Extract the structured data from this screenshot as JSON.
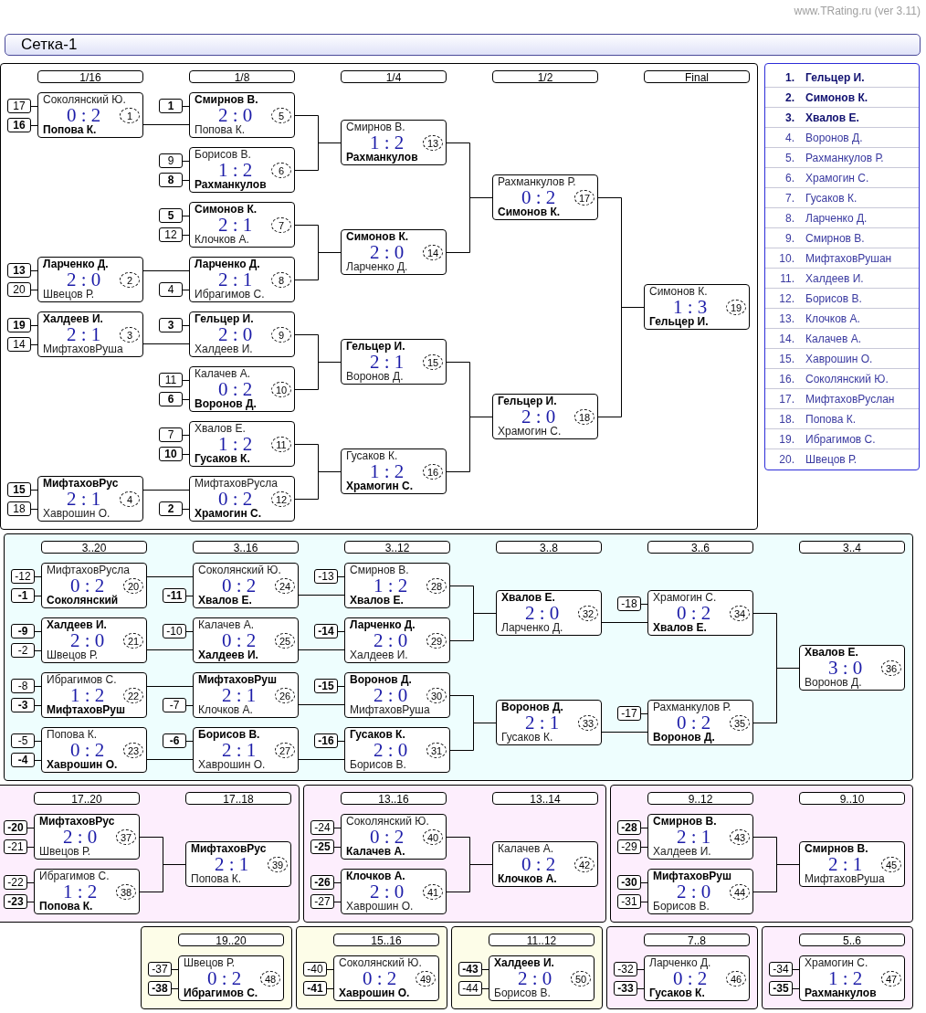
{
  "site": "www.TRating.ru (ver 3.11)",
  "title": "Сетка-1",
  "standings": [
    {
      "rank": "1.",
      "name": "Гельцер И.",
      "highlighted": true
    },
    {
      "rank": "2.",
      "name": "Симонов К.",
      "highlighted": true
    },
    {
      "rank": "3.",
      "name": "Хвалов Е.",
      "highlighted": true
    },
    {
      "rank": "4.",
      "name": "Воронов Д.",
      "highlighted": false
    },
    {
      "rank": "5.",
      "name": "Рахманкулов Р.",
      "highlighted": false
    },
    {
      "rank": "6.",
      "name": "Храмогин С.",
      "highlighted": false
    },
    {
      "rank": "7.",
      "name": "Гусаков К.",
      "highlighted": false
    },
    {
      "rank": "8.",
      "name": "Ларченко Д.",
      "highlighted": false
    },
    {
      "rank": "9.",
      "name": "Смирнов В.",
      "highlighted": false
    },
    {
      "rank": "10.",
      "name": "МифтаховРушан",
      "highlighted": false
    },
    {
      "rank": "11.",
      "name": "Халдеев И.",
      "highlighted": false
    },
    {
      "rank": "12.",
      "name": "Борисов В.",
      "highlighted": false
    },
    {
      "rank": "13.",
      "name": "Клочков А.",
      "highlighted": false
    },
    {
      "rank": "14.",
      "name": "Калачев А.",
      "highlighted": false
    },
    {
      "rank": "15.",
      "name": "Хаврошин О.",
      "highlighted": false
    },
    {
      "rank": "16.",
      "name": "Соколянский Ю.",
      "highlighted": false
    },
    {
      "rank": "17.",
      "name": "МифтаховРуслан",
      "highlighted": false
    },
    {
      "rank": "18.",
      "name": "Попова К.",
      "highlighted": false
    },
    {
      "rank": "19.",
      "name": "Ибрагимов С.",
      "highlighted": false
    },
    {
      "rank": "20.",
      "name": "Швецов Р.",
      "highlighted": false
    }
  ],
  "rows": [
    {
      "panels": [
        {
          "color": "#ffffff",
          "rounds": [
            "1/16",
            "1/8",
            "1/4",
            "1/2",
            "Final"
          ],
          "final": {
            "number": "19",
            "score": "1 : 3",
            "players": [
              {
                "name": "Симонов К.",
                "winner": false
              },
              {
                "name": "Гельцер И.",
                "winner": true
              }
            ],
            "feeders": [
              {
                "number": "17",
                "score": "0 : 2",
                "players": [
                  {
                    "name": "Рахманкулов Р.",
                    "winner": false
                  },
                  {
                    "name": "Симонов К.",
                    "winner": true
                  }
                ],
                "feeders": [
                  {
                    "number": "13",
                    "score": "1 : 2",
                    "players": [
                      {
                        "name": "Смирнов В.",
                        "winner": false
                      },
                      {
                        "name": "Рахманкулов",
                        "winner": true
                      }
                    ],
                    "feeders": [
                      {
                        "number": "5",
                        "score": "2 : 0",
                        "players": [
                          {
                            "seed": "1",
                            "name": "Смирнов В.",
                            "winner": true
                          },
                          {
                            "name": "Попова К.",
                            "winner": false
                          }
                        ],
                        "feeders": [
                          {
                            "number": "1",
                            "score": "0 : 2",
                            "players": [
                              {
                                "seed": "17",
                                "name": "Соколянский Ю.",
                                "winner": false
                              },
                              {
                                "seed": "16",
                                "name": "Попова К.",
                                "winner": true
                              }
                            ]
                          }
                        ]
                      },
                      {
                        "number": "6",
                        "score": "1 : 2",
                        "players": [
                          {
                            "seed": "9",
                            "name": "Борисов В.",
                            "winner": false
                          },
                          {
                            "seed": "8",
                            "name": "Рахманкулов",
                            "winner": true
                          }
                        ]
                      }
                    ]
                  },
                  {
                    "number": "14",
                    "score": "2 : 0",
                    "players": [
                      {
                        "name": "Симонов К.",
                        "winner": true
                      },
                      {
                        "name": "Ларченко Д.",
                        "winner": false
                      }
                    ],
                    "feeders": [
                      {
                        "number": "7",
                        "score": "2 : 1",
                        "players": [
                          {
                            "seed": "5",
                            "name": "Симонов К.",
                            "winner": true
                          },
                          {
                            "seed": "12",
                            "name": "Клочков А.",
                            "winner": false
                          }
                        ]
                      },
                      {
                        "number": "8",
                        "score": "2 : 1",
                        "players": [
                          {
                            "name": "Ларченко Д.",
                            "winner": true
                          },
                          {
                            "seed": "4",
                            "name": "Ибрагимов С.",
                            "winner": false
                          }
                        ],
                        "feeders": [
                          {
                            "number": "2",
                            "score": "2 : 0",
                            "players": [
                              {
                                "seed": "13",
                                "name": "Ларченко Д.",
                                "winner": true
                              },
                              {
                                "seed": "20",
                                "name": "Швецов Р.",
                                "winner": false
                              }
                            ]
                          }
                        ]
                      }
                    ]
                  }
                ]
              },
              {
                "number": "18",
                "score": "2 : 0",
                "players": [
                  {
                    "name": "Гельцер И.",
                    "winner": true
                  },
                  {
                    "name": "Храмогин С.",
                    "winner": false
                  }
                ],
                "feeders": [
                  {
                    "number": "15",
                    "score": "2 : 1",
                    "players": [
                      {
                        "name": "Гельцер И.",
                        "winner": true
                      },
                      {
                        "name": "Воронов Д.",
                        "winner": false
                      }
                    ],
                    "feeders": [
                      {
                        "number": "9",
                        "score": "2 : 0",
                        "players": [
                          {
                            "seed": "3",
                            "name": "Гельцер И.",
                            "winner": true
                          },
                          {
                            "name": "Халдеев И.",
                            "winner": false
                          }
                        ],
                        "feeders": [
                          {
                            "number": "3",
                            "score": "2 : 1",
                            "players": [
                              {
                                "seed": "19",
                                "name": "Халдеев И.",
                                "winner": true
                              },
                              {
                                "seed": "14",
                                "name": "МифтаховРуша",
                                "winner": false
                              }
                            ]
                          }
                        ]
                      },
                      {
                        "number": "10",
                        "score": "0 : 2",
                        "players": [
                          {
                            "seed": "11",
                            "name": "Калачев А.",
                            "winner": false
                          },
                          {
                            "seed": "6",
                            "name": "Воронов Д.",
                            "winner": true
                          }
                        ]
                      }
                    ]
                  },
                  {
                    "number": "16",
                    "score": "1 : 2",
                    "players": [
                      {
                        "name": "Гусаков К.",
                        "winner": false
                      },
                      {
                        "name": "Храмогин С.",
                        "winner": true
                      }
                    ],
                    "feeders": [
                      {
                        "number": "11",
                        "score": "1 : 2",
                        "players": [
                          {
                            "seed": "7",
                            "name": "Хвалов Е.",
                            "winner": false
                          },
                          {
                            "seed": "10",
                            "name": "Гусаков К.",
                            "winner": true
                          }
                        ]
                      },
                      {
                        "number": "12",
                        "score": "0 : 2",
                        "players": [
                          {
                            "name": "МифтаховРусла",
                            "winner": false
                          },
                          {
                            "seed": "2",
                            "name": "Храмогин С.",
                            "winner": true
                          }
                        ],
                        "feeders": [
                          {
                            "number": "4",
                            "score": "2 : 1",
                            "players": [
                              {
                                "seed": "15",
                                "name": "МифтаховРус",
                                "winner": true
                              },
                              {
                                "seed": "18",
                                "name": "Хаврошин О.",
                                "winner": false
                              }
                            ]
                          }
                        ]
                      }
                    ]
                  }
                ]
              }
            ]
          }
        }
      ]
    },
    {
      "panels": [
        {
          "color": "#eefefe",
          "rounds": [
            "3..20",
            "3..16",
            "3..12",
            "3..8",
            "3..6",
            "3..4"
          ],
          "final": {
            "number": "36",
            "score": "3 : 0",
            "players": [
              {
                "name": "Хвалов Е.",
                "winner": true
              },
              {
                "name": "Воронов Д.",
                "winner": false
              }
            ],
            "feeders": [
              {
                "number": "34",
                "score": "0 : 2",
                "players": [
                  {
                    "seed": "-18",
                    "name": "Храмогин С.",
                    "winner": false
                  },
                  {
                    "name": "Хвалов Е.",
                    "winner": true
                  }
                ],
                "feeders": [
                  {
                    "number": "32",
                    "score": "2 : 0",
                    "players": [
                      {
                        "name": "Хвалов Е.",
                        "winner": true
                      },
                      {
                        "name": "Ларченко Д.",
                        "winner": false
                      }
                    ],
                    "feeders": [
                      {
                        "number": "28",
                        "score": "1 : 2",
                        "players": [
                          {
                            "seed": "-13",
                            "name": "Смирнов В.",
                            "winner": false
                          },
                          {
                            "name": "Хвалов Е.",
                            "winner": true
                          }
                        ],
                        "feeders": [
                          {
                            "number": "24",
                            "score": "0 : 2",
                            "players": [
                              {
                                "name": "Соколянский Ю.",
                                "winner": false
                              },
                              {
                                "seed": "-11",
                                "name": "Хвалов Е.",
                                "winner": true
                              }
                            ],
                            "feeders": [
                              {
                                "number": "20",
                                "score": "0 : 2",
                                "players": [
                                  {
                                    "seed": "-12",
                                    "name": "МифтаховРусла",
                                    "winner": false
                                  },
                                  {
                                    "seed": "-1",
                                    "name": "Соколянский",
                                    "winner": true
                                  }
                                ]
                              }
                            ]
                          }
                        ]
                      },
                      {
                        "number": "29",
                        "score": "2 : 0",
                        "players": [
                          {
                            "seed": "-14",
                            "name": "Ларченко Д.",
                            "winner": true
                          },
                          {
                            "name": "Халдеев И.",
                            "winner": false
                          }
                        ],
                        "feeders": [
                          {
                            "number": "25",
                            "score": "0 : 2",
                            "players": [
                              {
                                "seed": "-10",
                                "name": "Калачев А.",
                                "winner": false
                              },
                              {
                                "name": "Халдеев И.",
                                "winner": true
                              }
                            ],
                            "feeders": [
                              {
                                "number": "21",
                                "score": "2 : 0",
                                "players": [
                                  {
                                    "seed": "-9",
                                    "name": "Халдеев И.",
                                    "winner": true
                                  },
                                  {
                                    "seed": "-2",
                                    "name": "Швецов Р.",
                                    "winner": false
                                  }
                                ]
                              }
                            ]
                          }
                        ]
                      }
                    ]
                  }
                ]
              },
              {
                "number": "35",
                "score": "0 : 2",
                "players": [
                  {
                    "seed": "-17",
                    "name": "Рахманкулов Р.",
                    "winner": false
                  },
                  {
                    "name": "Воронов Д.",
                    "winner": true
                  }
                ],
                "feeders": [
                  {
                    "number": "33",
                    "score": "2 : 1",
                    "players": [
                      {
                        "name": "Воронов Д.",
                        "winner": true
                      },
                      {
                        "name": "Гусаков К.",
                        "winner": false
                      }
                    ],
                    "feeders": [
                      {
                        "number": "30",
                        "score": "2 : 0",
                        "players": [
                          {
                            "seed": "-15",
                            "name": "Воронов Д.",
                            "winner": true
                          },
                          {
                            "name": "МифтаховРуша",
                            "winner": false
                          }
                        ],
                        "feeders": [
                          {
                            "number": "26",
                            "score": "2 : 1",
                            "players": [
                              {
                                "name": "МифтаховРуш",
                                "winner": true
                              },
                              {
                                "seed": "-7",
                                "name": "Клочков А.",
                                "winner": false
                              }
                            ],
                            "feeders": [
                              {
                                "number": "22",
                                "score": "1 : 2",
                                "players": [
                                  {
                                    "seed": "-8",
                                    "name": "Ибрагимов С.",
                                    "winner": false
                                  },
                                  {
                                    "seed": "-3",
                                    "name": "МифтаховРуш",
                                    "winner": true
                                  }
                                ]
                              }
                            ]
                          }
                        ]
                      },
                      {
                        "number": "31",
                        "score": "2 : 0",
                        "players": [
                          {
                            "seed": "-16",
                            "name": "Гусаков К.",
                            "winner": true
                          },
                          {
                            "name": "Борисов В.",
                            "winner": false
                          }
                        ],
                        "feeders": [
                          {
                            "number": "27",
                            "score": "2 : 1",
                            "players": [
                              {
                                "seed": "-6",
                                "name": "Борисов В.",
                                "winner": true
                              },
                              {
                                "name": "Хаврошин О.",
                                "winner": false
                              }
                            ],
                            "feeders": [
                              {
                                "number": "23",
                                "score": "0 : 2",
                                "players": [
                                  {
                                    "seed": "-5",
                                    "name": "Попова К.",
                                    "winner": false
                                  },
                                  {
                                    "seed": "-4",
                                    "name": "Хаврошин О.",
                                    "winner": true
                                  }
                                ]
                              }
                            ]
                          }
                        ]
                      }
                    ]
                  }
                ]
              }
            ]
          }
        }
      ]
    },
    {
      "panels": [
        {
          "color": "#fdeefd",
          "rounds": [
            "17..20",
            "17..18"
          ],
          "final": {
            "number": "39",
            "score": "2 : 1",
            "players": [
              {
                "name": "МифтаховРус",
                "winner": true
              },
              {
                "name": "Попова К.",
                "winner": false
              }
            ],
            "feeders": [
              {
                "number": "37",
                "score": "2 : 0",
                "players": [
                  {
                    "seed": "-20",
                    "name": "МифтаховРус",
                    "winner": true
                  },
                  {
                    "seed": "-21",
                    "name": "Швецов Р.",
                    "winner": false
                  }
                ]
              },
              {
                "number": "38",
                "score": "1 : 2",
                "players": [
                  {
                    "seed": "-22",
                    "name": "Ибрагимов С.",
                    "winner": false
                  },
                  {
                    "seed": "-23",
                    "name": "Попова К.",
                    "winner": true
                  }
                ]
              }
            ]
          }
        },
        {
          "color": "#fdeefd",
          "rounds": [
            "13..16",
            "13..14"
          ],
          "final": {
            "number": "42",
            "score": "0 : 2",
            "players": [
              {
                "name": "Калачев А.",
                "winner": false
              },
              {
                "name": "Клочков А.",
                "winner": true
              }
            ],
            "feeders": [
              {
                "number": "40",
                "score": "0 : 2",
                "players": [
                  {
                    "seed": "-24",
                    "name": "Соколянский Ю.",
                    "winner": false
                  },
                  {
                    "seed": "-25",
                    "name": "Калачев А.",
                    "winner": true
                  }
                ]
              },
              {
                "number": "41",
                "score": "2 : 0",
                "players": [
                  {
                    "seed": "-26",
                    "name": "Клочков А.",
                    "winner": true
                  },
                  {
                    "seed": "-27",
                    "name": "Хаврошин О.",
                    "winner": false
                  }
                ]
              }
            ]
          }
        },
        {
          "color": "#fdeefd",
          "rounds": [
            "9..12",
            "9..10"
          ],
          "final": {
            "number": "45",
            "score": "2 : 1",
            "players": [
              {
                "name": "Смирнов В.",
                "winner": true
              },
              {
                "name": "МифтаховРуша",
                "winner": false
              }
            ],
            "feeders": [
              {
                "number": "43",
                "score": "2 : 1",
                "players": [
                  {
                    "seed": "-28",
                    "name": "Смирнов В.",
                    "winner": true
                  },
                  {
                    "seed": "-29",
                    "name": "Халдеев И.",
                    "winner": false
                  }
                ]
              },
              {
                "number": "44",
                "score": "2 : 0",
                "players": [
                  {
                    "seed": "-30",
                    "name": "МифтаховРуш",
                    "winner": true
                  },
                  {
                    "seed": "-31",
                    "name": "Борисов В.",
                    "winner": false
                  }
                ]
              }
            ]
          }
        }
      ]
    },
    {
      "panels": [
        {
          "color": "#fdfde8",
          "rounds": [
            "19..20"
          ],
          "final": {
            "number": "48",
            "score": "0 : 2",
            "players": [
              {
                "seed": "-37",
                "name": "Швецов Р.",
                "winner": false
              },
              {
                "seed": "-38",
                "name": "Ибрагимов С.",
                "winner": true
              }
            ]
          }
        },
        {
          "color": "#fdfde8",
          "rounds": [
            "15..16"
          ],
          "final": {
            "number": "49",
            "score": "0 : 2",
            "players": [
              {
                "seed": "-40",
                "name": "Соколянский Ю.",
                "winner": false
              },
              {
                "seed": "-41",
                "name": "Хаврошин О.",
                "winner": true
              }
            ]
          }
        },
        {
          "color": "#fdfde8",
          "rounds": [
            "11..12"
          ],
          "final": {
            "number": "50",
            "score": "2 : 0",
            "players": [
              {
                "seed": "-43",
                "name": "Халдеев И.",
                "winner": true
              },
              {
                "seed": "-44",
                "name": "Борисов В.",
                "winner": false
              }
            ]
          }
        },
        {
          "color": "#fdeefd",
          "rounds": [
            "7..8"
          ],
          "final": {
            "number": "46",
            "score": "0 : 2",
            "players": [
              {
                "seed": "-32",
                "name": "Ларченко Д.",
                "winner": false
              },
              {
                "seed": "-33",
                "name": "Гусаков К.",
                "winner": true
              }
            ]
          }
        },
        {
          "color": "#fdeefd",
          "rounds": [
            "5..6"
          ],
          "final": {
            "number": "47",
            "score": "1 : 2",
            "players": [
              {
                "seed": "-34",
                "name": "Храмогин С.",
                "winner": false
              },
              {
                "seed": "-35",
                "name": "Рахманкулов",
                "winner": true
              }
            ]
          }
        }
      ]
    }
  ]
}
